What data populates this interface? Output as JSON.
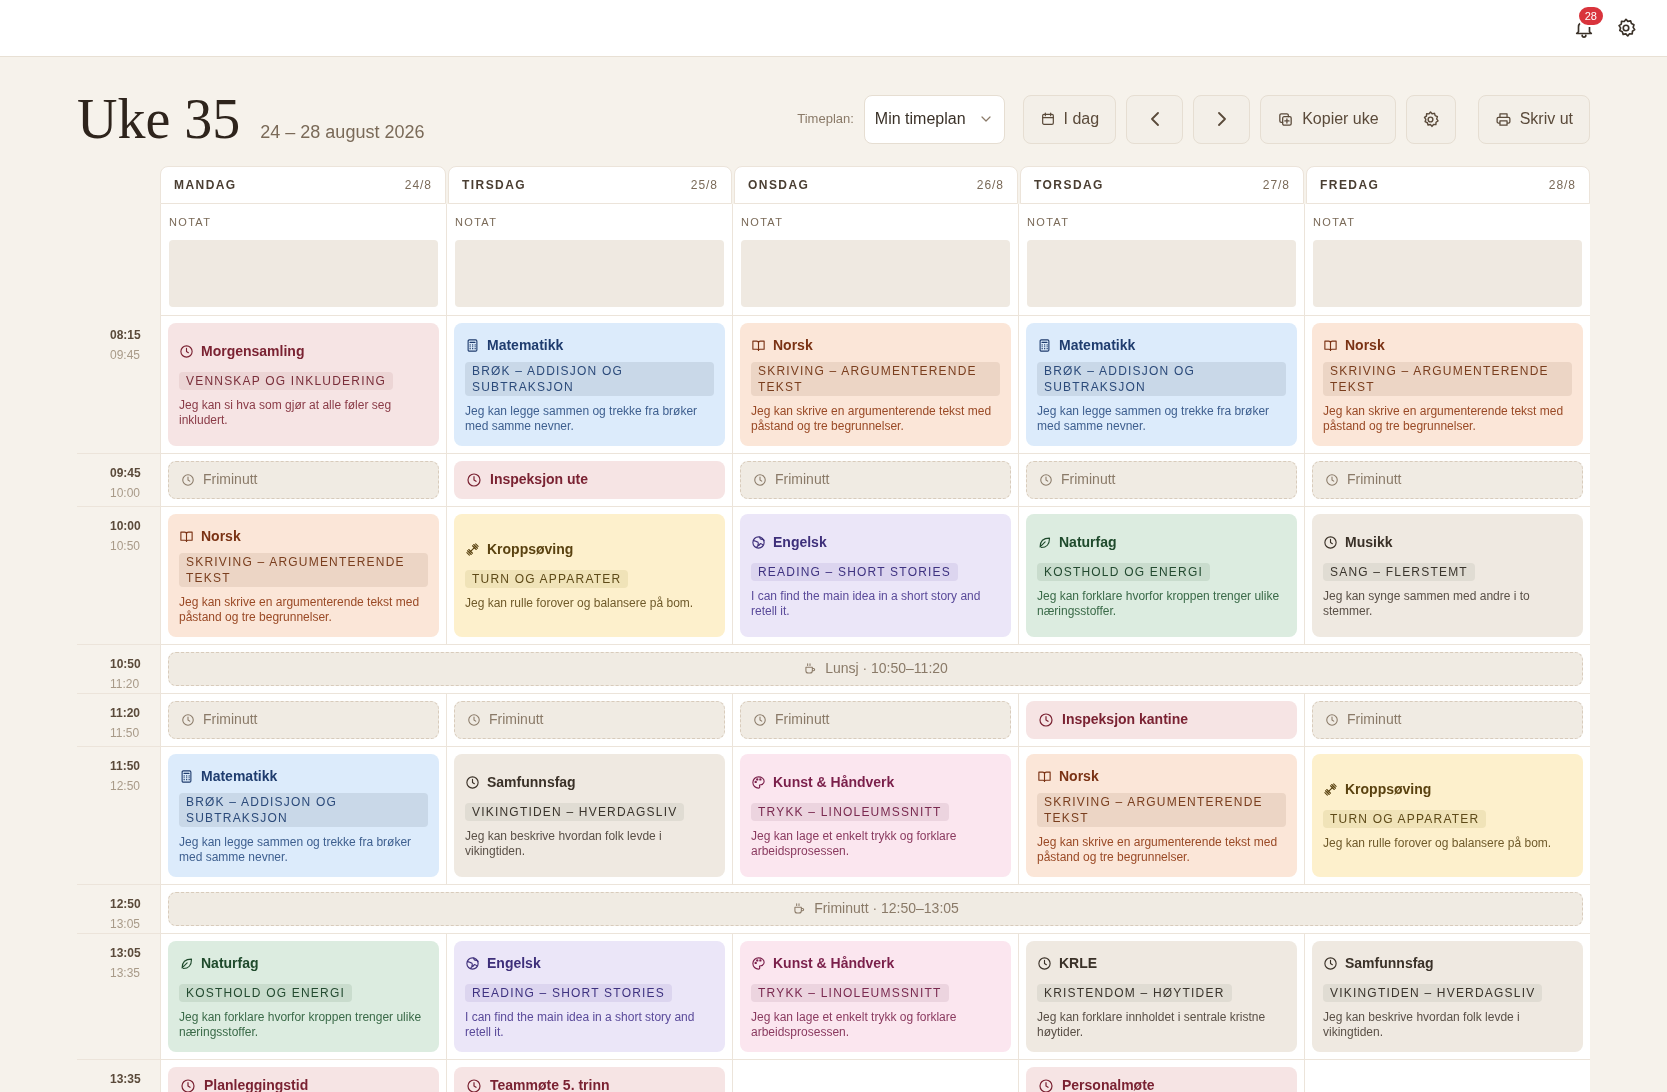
{
  "topbar": {
    "notifications": "28"
  },
  "header": {
    "title": "Uke 35",
    "range": "24 – 28 august 2026",
    "timetable_label": "Timeplan:",
    "timetable_value": "Min timeplan",
    "buttons": {
      "today": "I dag",
      "copy": "Kopier uke",
      "print": "Skriv ut"
    }
  },
  "days": [
    {
      "name": "MANDAG",
      "date": "24/8",
      "note_label": "NOTAT"
    },
    {
      "name": "TIRSDAG",
      "date": "25/8",
      "note_label": "NOTAT"
    },
    {
      "name": "ONSDAG",
      "date": "26/8",
      "note_label": "NOTAT"
    },
    {
      "name": "TORSDAG",
      "date": "27/8",
      "note_label": "NOTAT"
    },
    {
      "name": "FREDAG",
      "date": "28/8",
      "note_label": "NOTAT"
    }
  ],
  "rows": [
    {
      "kind": "cells",
      "start": "08:15",
      "end": "09:45",
      "cells": [
        {
          "kind": "assembly",
          "title": "Morgensamling",
          "topic": "VENNSKAP OG INKLUDERING",
          "goal": "Jeg kan si hva som gjør at alle føler seg inkludert."
        },
        {
          "kind": "math",
          "title": "Matematikk",
          "topic": "BRØK – ADDISJON OG SUBTRAKSJON",
          "goal": "Jeg kan legge sammen og trekke fra brøker med samme nevner."
        },
        {
          "kind": "norsk",
          "title": "Norsk",
          "topic": "SKRIVING – ARGUMENTERENDE TEKST",
          "goal": "Jeg kan skrive en argumenterende tekst med påstand og tre begrunnelser."
        },
        {
          "kind": "math",
          "title": "Matematikk",
          "topic": "BRØK – ADDISJON OG SUBTRAKSJON",
          "goal": "Jeg kan legge sammen og trekke fra brøker med samme nevner."
        },
        {
          "kind": "norsk",
          "title": "Norsk",
          "topic": "SKRIVING – ARGUMENTERENDE TEKST",
          "goal": "Jeg kan skrive en argumenterende tekst med påstand og tre begrunnelser."
        }
      ]
    },
    {
      "kind": "cells",
      "start": "09:45",
      "end": "10:00",
      "cells": [
        {
          "kind": "break",
          "title": "Friminutt"
        },
        {
          "kind": "duty",
          "title": "Inspeksjon ute"
        },
        {
          "kind": "break",
          "title": "Friminutt"
        },
        {
          "kind": "break",
          "title": "Friminutt"
        },
        {
          "kind": "break",
          "title": "Friminutt"
        }
      ]
    },
    {
      "kind": "cells",
      "start": "10:00",
      "end": "10:50",
      "cells": [
        {
          "kind": "norsk",
          "title": "Norsk",
          "topic": "SKRIVING – ARGUMENTERENDE TEKST",
          "goal": "Jeg kan skrive en argumenterende tekst med påstand og tre begrunnelser."
        },
        {
          "kind": "pe",
          "title": "Kroppsøving",
          "topic": "TURN OG APPARATER",
          "goal": "Jeg kan rulle forover og balansere på bom."
        },
        {
          "kind": "english",
          "title": "Engelsk",
          "topic": "READING – SHORT STORIES",
          "goal": "I can find the main idea in a short story and retell it."
        },
        {
          "kind": "science",
          "title": "Naturfag",
          "topic": "KOSTHOLD OG ENERGI",
          "goal": "Jeg kan forklare hvorfor kroppen trenger ulike næringsstoffer."
        },
        {
          "kind": "social",
          "title": "Musikk",
          "topic": "SANG – FLERSTEMT",
          "goal": "Jeg kan synge sammen med andre i to stemmer."
        }
      ]
    },
    {
      "kind": "span",
      "start": "10:50",
      "end": "11:20",
      "label": "Lunsj · 10:50–11:20"
    },
    {
      "kind": "cells",
      "start": "11:20",
      "end": "11:50",
      "cells": [
        {
          "kind": "break",
          "title": "Friminutt"
        },
        {
          "kind": "break",
          "title": "Friminutt"
        },
        {
          "kind": "break",
          "title": "Friminutt"
        },
        {
          "kind": "duty",
          "title": "Inspeksjon kantine"
        },
        {
          "kind": "break",
          "title": "Friminutt"
        }
      ]
    },
    {
      "kind": "cells",
      "start": "11:50",
      "end": "12:50",
      "cells": [
        {
          "kind": "math",
          "title": "Matematikk",
          "topic": "BRØK – ADDISJON OG SUBTRAKSJON",
          "goal": "Jeg kan legge sammen og trekke fra brøker med samme nevner."
        },
        {
          "kind": "social",
          "title": "Samfunnsfag",
          "topic": "VIKINGTIDEN – HVERDAGSLIV",
          "goal": "Jeg kan beskrive hvordan folk levde i vikingtiden."
        },
        {
          "kind": "arts",
          "title": "Kunst & Håndverk",
          "topic": "TRYKK – LINOLEUMSSNITT",
          "goal": "Jeg kan lage et enkelt trykk og forklare arbeidsprosessen."
        },
        {
          "kind": "norsk",
          "title": "Norsk",
          "topic": "SKRIVING – ARGUMENTERENDE TEKST",
          "goal": "Jeg kan skrive en argumenterende tekst med påstand og tre begrunnelser."
        },
        {
          "kind": "pe",
          "title": "Kroppsøving",
          "topic": "TURN OG APPARATER",
          "goal": "Jeg kan rulle forover og balansere på bom."
        }
      ]
    },
    {
      "kind": "span",
      "start": "12:50",
      "end": "13:05",
      "label": "Friminutt · 12:50–13:05"
    },
    {
      "kind": "cells",
      "start": "13:05",
      "end": "13:35",
      "cells": [
        {
          "kind": "science",
          "title": "Naturfag",
          "topic": "KOSTHOLD OG ENERGI",
          "goal": "Jeg kan forklare hvorfor kroppen trenger ulike næringsstoffer."
        },
        {
          "kind": "english",
          "title": "Engelsk",
          "topic": "READING – SHORT STORIES",
          "goal": "I can find the main idea in a short story and retell it."
        },
        {
          "kind": "arts",
          "title": "Kunst & Håndverk",
          "topic": "TRYKK – LINOLEUMSSNITT",
          "goal": "Jeg kan lage et enkelt trykk og forklare arbeidsprosessen."
        },
        {
          "kind": "social",
          "title": "KRLE",
          "topic": "KRISTENDOM – HØYTIDER",
          "goal": "Jeg kan forklare innholdet i sentrale kristne høytider."
        },
        {
          "kind": "social",
          "title": "Samfunnsfag",
          "topic": "VIKINGTIDEN – HVERDAGSLIV",
          "goal": "Jeg kan beskrive hvordan folk levde i vikingtiden."
        }
      ]
    },
    {
      "kind": "cells",
      "start": "13:35",
      "cells": [
        {
          "kind": "duty",
          "title": "Planleggingstid"
        },
        {
          "kind": "duty",
          "title": "Teammøte 5. trinn"
        },
        {
          "kind": "empty"
        },
        {
          "kind": "duty",
          "title": "Personalmøte"
        },
        {
          "kind": "empty"
        }
      ]
    }
  ]
}
